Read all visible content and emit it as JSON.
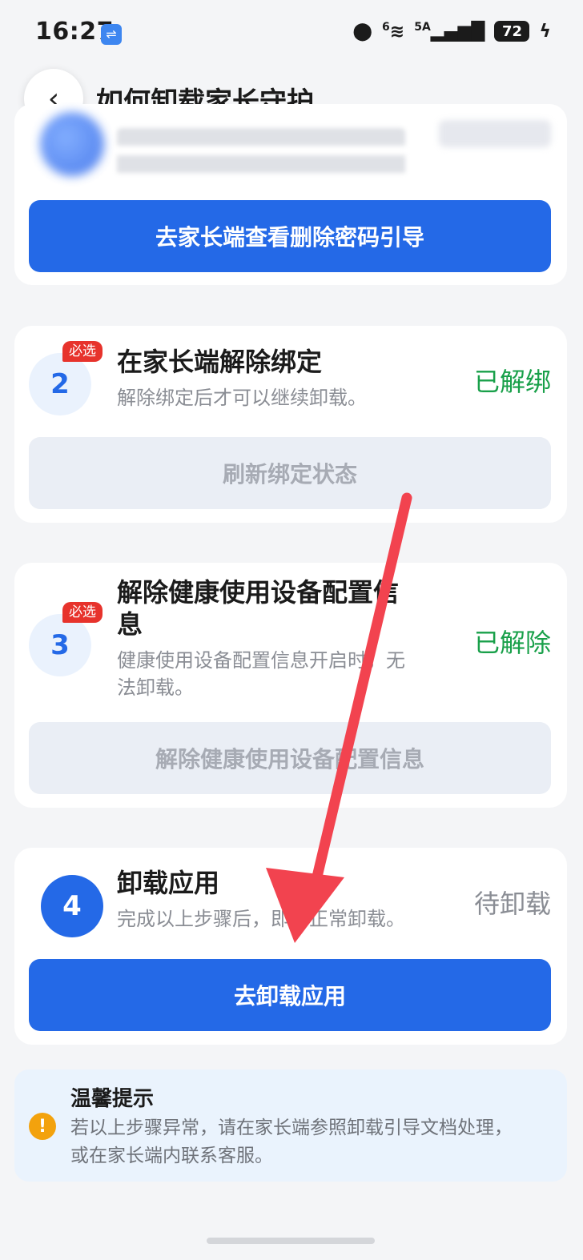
{
  "status_bar": {
    "time": "16:27",
    "usb_icon": "usb-icon",
    "signal_label_1": "6",
    "signal_label_2": "5A",
    "battery": "72"
  },
  "header": {
    "title": "如何卸载家长守护",
    "back_icon": "chevron-left-icon"
  },
  "step1": {
    "button": "去家长端查看删除密码引导"
  },
  "step2": {
    "number": "2",
    "badge": "必选",
    "title": "在家长端解除绑定",
    "desc": "解除绑定后才可以继续卸载。",
    "status": "已解绑",
    "button": "刷新绑定状态"
  },
  "step3": {
    "number": "3",
    "badge": "必选",
    "title_line1": "解除健康使用设备配置信",
    "title_line2": "息",
    "desc_line1": "健康使用设备配置信息开启时，无",
    "desc_line2": "法卸载。",
    "status": "已解除",
    "button": "解除健康使用设备配置信息"
  },
  "step4": {
    "number": "4",
    "title": "卸载应用",
    "desc": "完成以上步骤后，即可正常卸载。",
    "status": "待卸载",
    "button": "去卸载应用"
  },
  "tip": {
    "title": "温馨提示",
    "body_line1": "若以上步骤异常，请在家长端参照卸载引导文档处理，",
    "body_line2": "或在家长端内联系客服。"
  },
  "colors": {
    "primary": "#2469e7",
    "success": "#19a04a",
    "required": "#e7332c",
    "arrow": "#f2434f",
    "warning": "#f3a20d"
  }
}
